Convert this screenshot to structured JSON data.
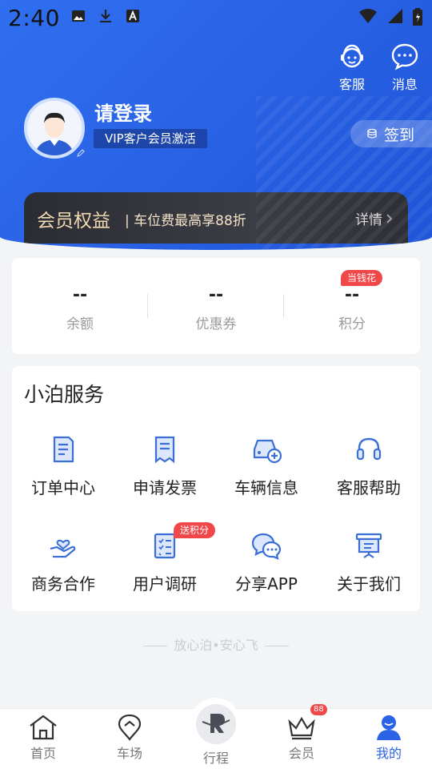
{
  "status_bar": {
    "time": "2:40",
    "left_icons": [
      "image-icon",
      "download-icon",
      "a-box-icon"
    ],
    "right_icons": [
      "wifi-icon",
      "signal-icon",
      "battery-icon"
    ]
  },
  "header": {
    "customer_service_label": "客服",
    "messages_label": "消息",
    "login_title": "请登录",
    "vip_badge": "VIP客户会员激活",
    "signin_label": "签到",
    "member_benefits": {
      "title": "会员权益",
      "subtitle": "| 车位费最高享88折",
      "detail_label": "详情"
    }
  },
  "stats": [
    {
      "value": "--",
      "label": "余额"
    },
    {
      "value": "--",
      "label": "优惠券"
    },
    {
      "value": "--",
      "label": "积分",
      "badge": "当钱花"
    }
  ],
  "services": {
    "title": "小泊服务",
    "items": [
      {
        "label": "订单中心",
        "icon": "order-doc-icon"
      },
      {
        "label": "申请发票",
        "icon": "invoice-icon"
      },
      {
        "label": "车辆信息",
        "icon": "car-add-icon"
      },
      {
        "label": "客服帮助",
        "icon": "headset-icon"
      },
      {
        "label": "商务合作",
        "icon": "hand-heart-icon"
      },
      {
        "label": "用户调研",
        "icon": "checklist-icon",
        "badge": "送积分"
      },
      {
        "label": "分享APP",
        "icon": "chat-bubbles-icon"
      },
      {
        "label": "关于我们",
        "icon": "presentation-board-icon"
      }
    ]
  },
  "slogan": "放心泊•安心飞",
  "bottom_nav": {
    "items": [
      {
        "label": "首页",
        "icon": "home-icon"
      },
      {
        "label": "车场",
        "icon": "location-pin-icon"
      },
      {
        "label": "行程",
        "icon": "trip-logo-icon"
      },
      {
        "label": "会员",
        "icon": "crown-icon",
        "badge": "88"
      },
      {
        "label": "我的",
        "icon": "profile-icon",
        "active": true
      }
    ]
  },
  "colors": {
    "primary": "#2b63e7",
    "header_gradient_start": "#2f6ff0",
    "member_gold": "#f1d9b1",
    "badge_red": "#f04848",
    "icon_blue": "#3c6fd6"
  }
}
